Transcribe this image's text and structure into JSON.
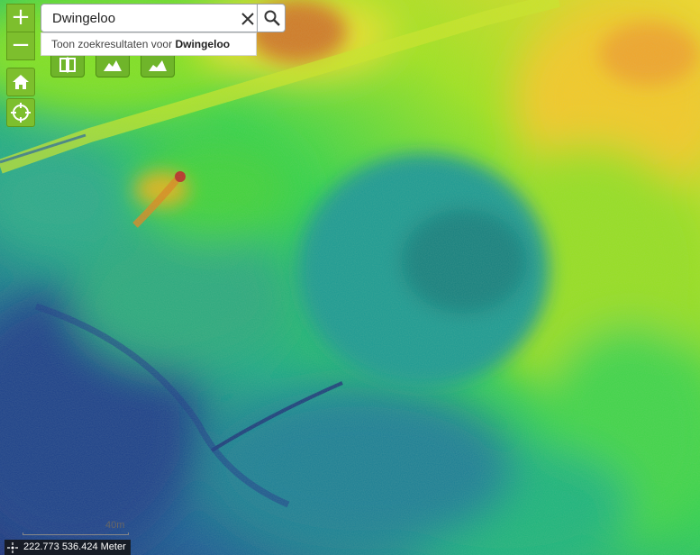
{
  "search": {
    "value": "Dwingeloo",
    "suggestion_prefix": "Toon zoekresultaten voor",
    "suggestion_term": "Dwingeloo"
  },
  "controls": {
    "zoom_in": "+",
    "zoom_out": "−"
  },
  "scalebar": {
    "label": "40m"
  },
  "coords": {
    "text": "222.773 536.424 Meter"
  },
  "icons": {
    "zoom_in": "plus-icon",
    "zoom_out": "minus-icon",
    "home": "home-icon",
    "locate": "locate-icon",
    "tool1": "layer-split-icon",
    "tool2": "terrain-profile-icon",
    "tool3": "terrain-elevation-icon",
    "clear": "close-icon",
    "search": "search-icon",
    "coords": "crosshair-icon"
  },
  "colors": {
    "button_green": "#7dbf2d",
    "elevation_low": "#1d2e7a",
    "elevation_mid": "#14c66a",
    "elevation_high": "#f2e21a",
    "elevation_peak": "#c0282a"
  }
}
